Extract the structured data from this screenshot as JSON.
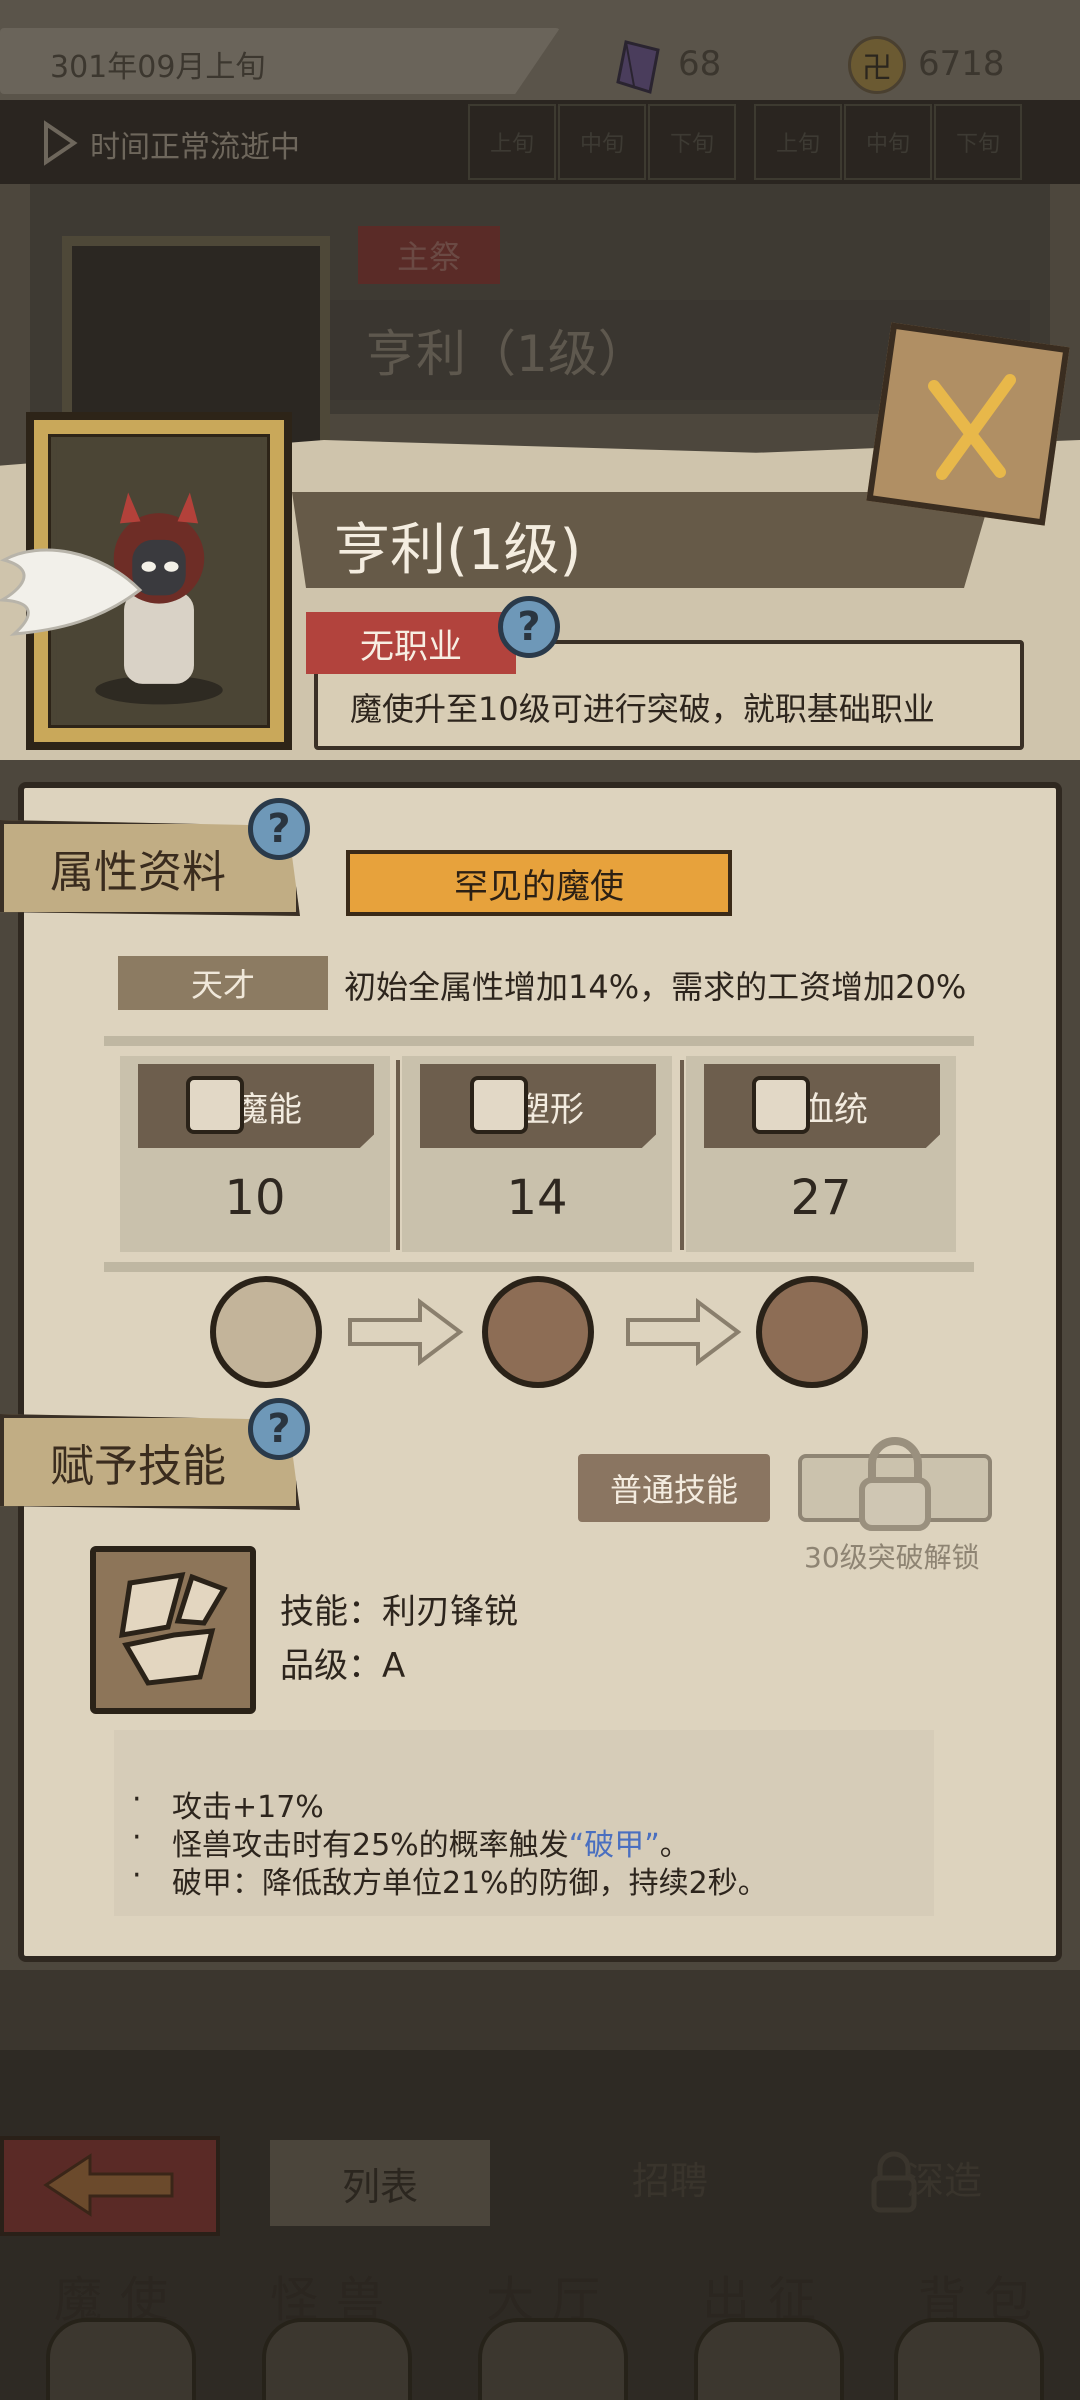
{
  "top_bar": {
    "date": "301年09月上旬",
    "crystal_count": "68",
    "coin_count": "6718",
    "coin_glyph": "卍"
  },
  "time_bar": {
    "status": "时间正常流逝中",
    "slots": [
      "上旬",
      "中旬",
      "下旬",
      "上旬",
      "中旬",
      "下旬"
    ]
  },
  "background": {
    "role_tag": "主祭",
    "name": "亨利（1级）"
  },
  "character": {
    "name": "亨利(1级)",
    "job": "无职业",
    "job_desc": "魔使升至10级可进行突破，就职基础职业"
  },
  "attributes": {
    "section_title": "属性资料",
    "rarity": "罕见的魔使",
    "talent_label": "天才",
    "talent_desc": "初始全属性增加14%，需求的工资增加20%",
    "stats": [
      {
        "name": "魔能",
        "value": "10"
      },
      {
        "name": "塑形",
        "value": "14"
      },
      {
        "name": "血统",
        "value": "27"
      }
    ]
  },
  "skills": {
    "section_title": "赋予技能",
    "normal_button": "普通技能",
    "unlock_text": "30级突破解锁",
    "skill_name": "技能：利刃锋锐",
    "skill_grade": "品级：A",
    "bullet": "·",
    "effects": {
      "e1": "攻击+17%",
      "e2_pre": "怪兽攻击时有25%的概率触发",
      "e2_hl": "“破甲”",
      "e2_post": "。",
      "e3": "破甲：降低敌方单位21%的防御，持续2秒。"
    }
  },
  "bottom_nav": {
    "list": "列表",
    "recruit": "招聘",
    "deep": "深造",
    "tabs": [
      "魔使",
      "怪兽",
      "大厅",
      "出征",
      "背包"
    ]
  },
  "colors": {
    "parchment": "#ddd3be",
    "job_tag_red": "#b2433d",
    "rarity_orange": "#e7a23c",
    "help_blue": "#6e98b8",
    "highlight_blue": "#4a6fc0"
  }
}
